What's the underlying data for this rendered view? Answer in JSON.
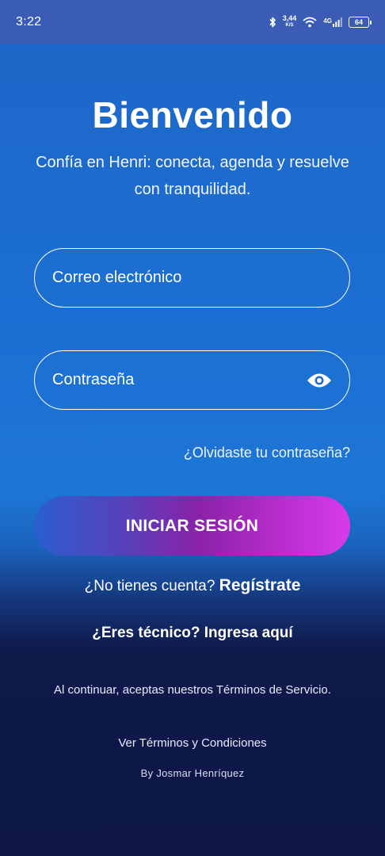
{
  "status_bar": {
    "time": "3:22",
    "speed_value": "3,44",
    "speed_unit": "K/S",
    "network": "4G",
    "battery": "64"
  },
  "header": {
    "title": "Bienvenido",
    "subtitle": "Confía en Henri: conecta, agenda y resuelve con tranquilidad."
  },
  "form": {
    "email_placeholder": "Correo electrónico",
    "password_placeholder": "Contraseña",
    "forgot_label": "¿Olvidaste tu contraseña?",
    "login_label": "INICIAR SESIÓN"
  },
  "signup": {
    "prompt": "¿No tienes cuenta?",
    "link": "Regístrate"
  },
  "technician": {
    "label": "¿Eres técnico? Ingresa aquí"
  },
  "footer": {
    "terms_text": "Al continuar, aceptas nuestros Términos de Servicio.",
    "terms_link": "Ver Términos y Condiciones",
    "byline": "By Josmar Henríquez"
  },
  "colors": {
    "background_top": "#1e66c8",
    "background_bottom": "#0e1747",
    "button_start": "#2a5fd0",
    "button_end": "#d63bec"
  },
  "icons": [
    "bluetooth-icon",
    "wifi-icon",
    "signal-icon",
    "battery-icon",
    "eye-icon"
  ]
}
